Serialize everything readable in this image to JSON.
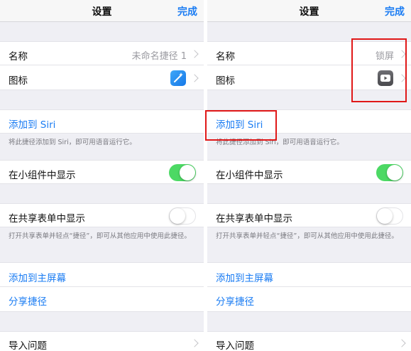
{
  "colors": {
    "accent": "#1a7cf3",
    "switch_on": "#4cd964",
    "highlight": "#e01818"
  },
  "left": {
    "title": "设置",
    "done": "完成",
    "name_label": "名称",
    "name_value": "未命名捷径 1",
    "icon_label": "图标",
    "icon_name": "magic-wand-icon",
    "add_siri": "添加到 Siri",
    "siri_note": "将此捷径添加到 Siri，即可用语音运行它。",
    "widget_label": "在小组件中显示",
    "widget_on": true,
    "share_label": "在共享表单中显示",
    "share_on": false,
    "share_note": "打开共享表单并轻点“捷径”，即可从其他应用中使用此捷径。",
    "add_home": "添加到主屏幕",
    "share_shortcut": "分享捷径",
    "import_question": "导入问题"
  },
  "right": {
    "title": "设置",
    "done": "完成",
    "name_label": "名称",
    "name_value": "锁屏",
    "icon_label": "图标",
    "icon_name": "play-icon",
    "add_siri": "添加到 Siri",
    "siri_note": "将此捷径添加到 Siri，即可用语音运行它。",
    "widget_label": "在小组件中显示",
    "widget_on": true,
    "share_label": "在共享表单中显示",
    "share_on": false,
    "share_note": "打开共享表单并轻点“捷径”，即可从其他应用中使用此捷径。",
    "add_home": "添加到主屏幕",
    "share_shortcut": "分享捷径",
    "import_question": "导入问题"
  }
}
